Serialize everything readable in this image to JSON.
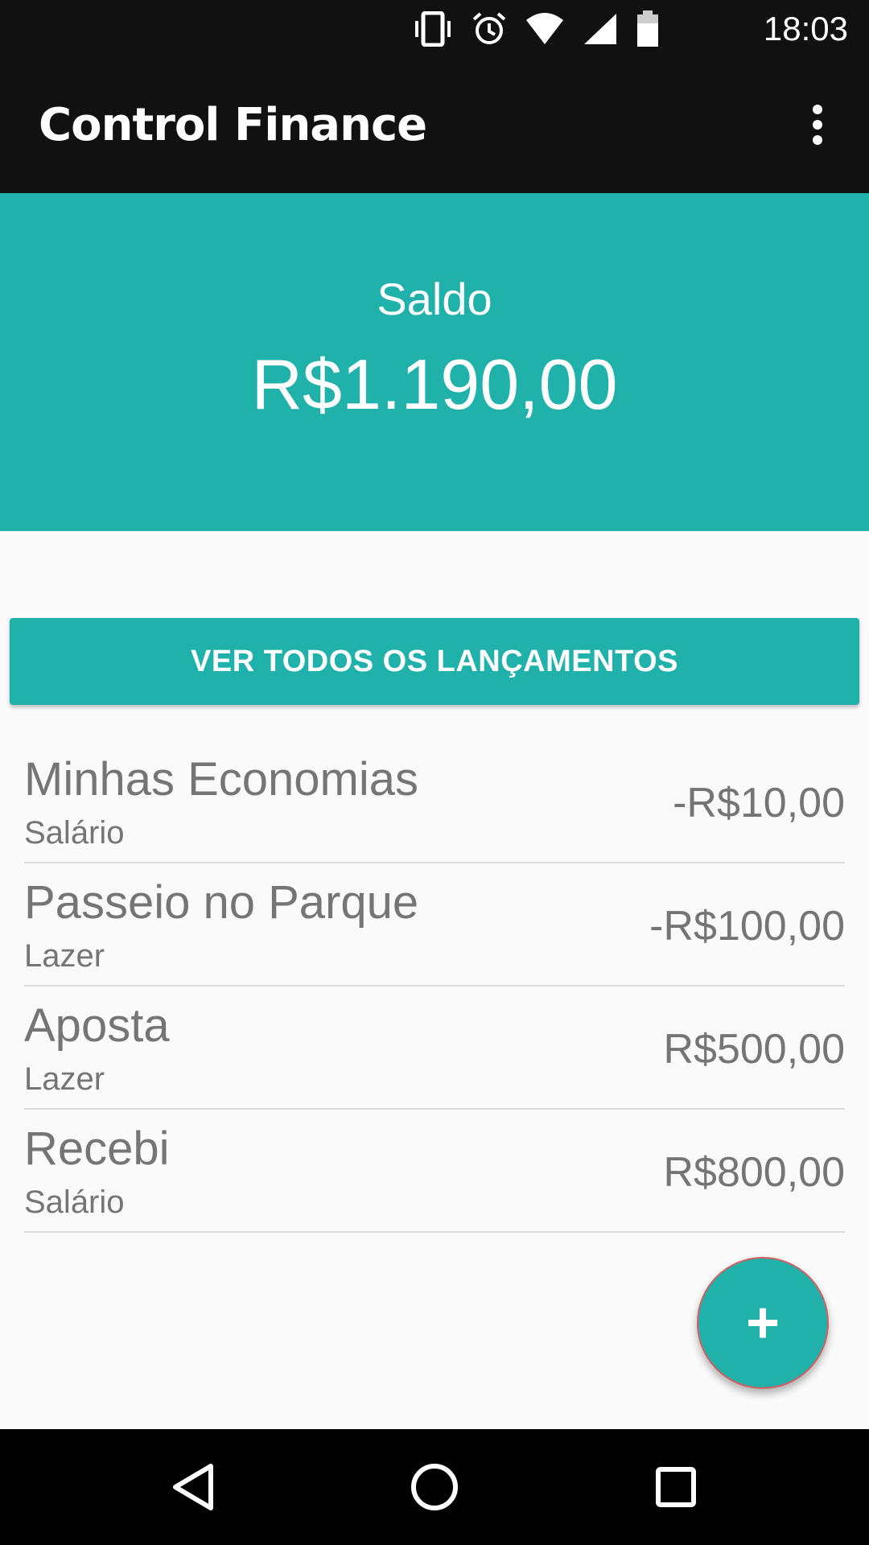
{
  "status_bar": {
    "time": "18:03",
    "icons": [
      "vibrate-icon",
      "alarm-icon",
      "wifi-icon",
      "signal-icon",
      "battery-icon"
    ]
  },
  "app_bar": {
    "title": "Control Finance",
    "menu_icon": "more-vert-icon"
  },
  "balance": {
    "label": "Saldo",
    "value": "R$1.190,00"
  },
  "all_entries_button": {
    "label": "VER TODOS OS LANÇAMENTOS"
  },
  "entries": [
    {
      "title": "Minhas Economias",
      "category": "Salário",
      "amount": "-R$10,00"
    },
    {
      "title": "Passeio no Parque",
      "category": "Lazer",
      "amount": "-R$100,00"
    },
    {
      "title": "Aposta",
      "category": "Lazer",
      "amount": "R$500,00"
    },
    {
      "title": "Recebi",
      "category": "Salário",
      "amount": "R$800,00"
    }
  ],
  "fab": {
    "icon": "add-icon",
    "label": "+"
  },
  "nav_bar": {
    "icons": [
      "back-icon",
      "home-icon",
      "recents-icon"
    ]
  },
  "colors": {
    "primary": "#20b2aa",
    "toolbar": "#111111",
    "background": "#fafafa",
    "text_secondary": "#757575"
  }
}
